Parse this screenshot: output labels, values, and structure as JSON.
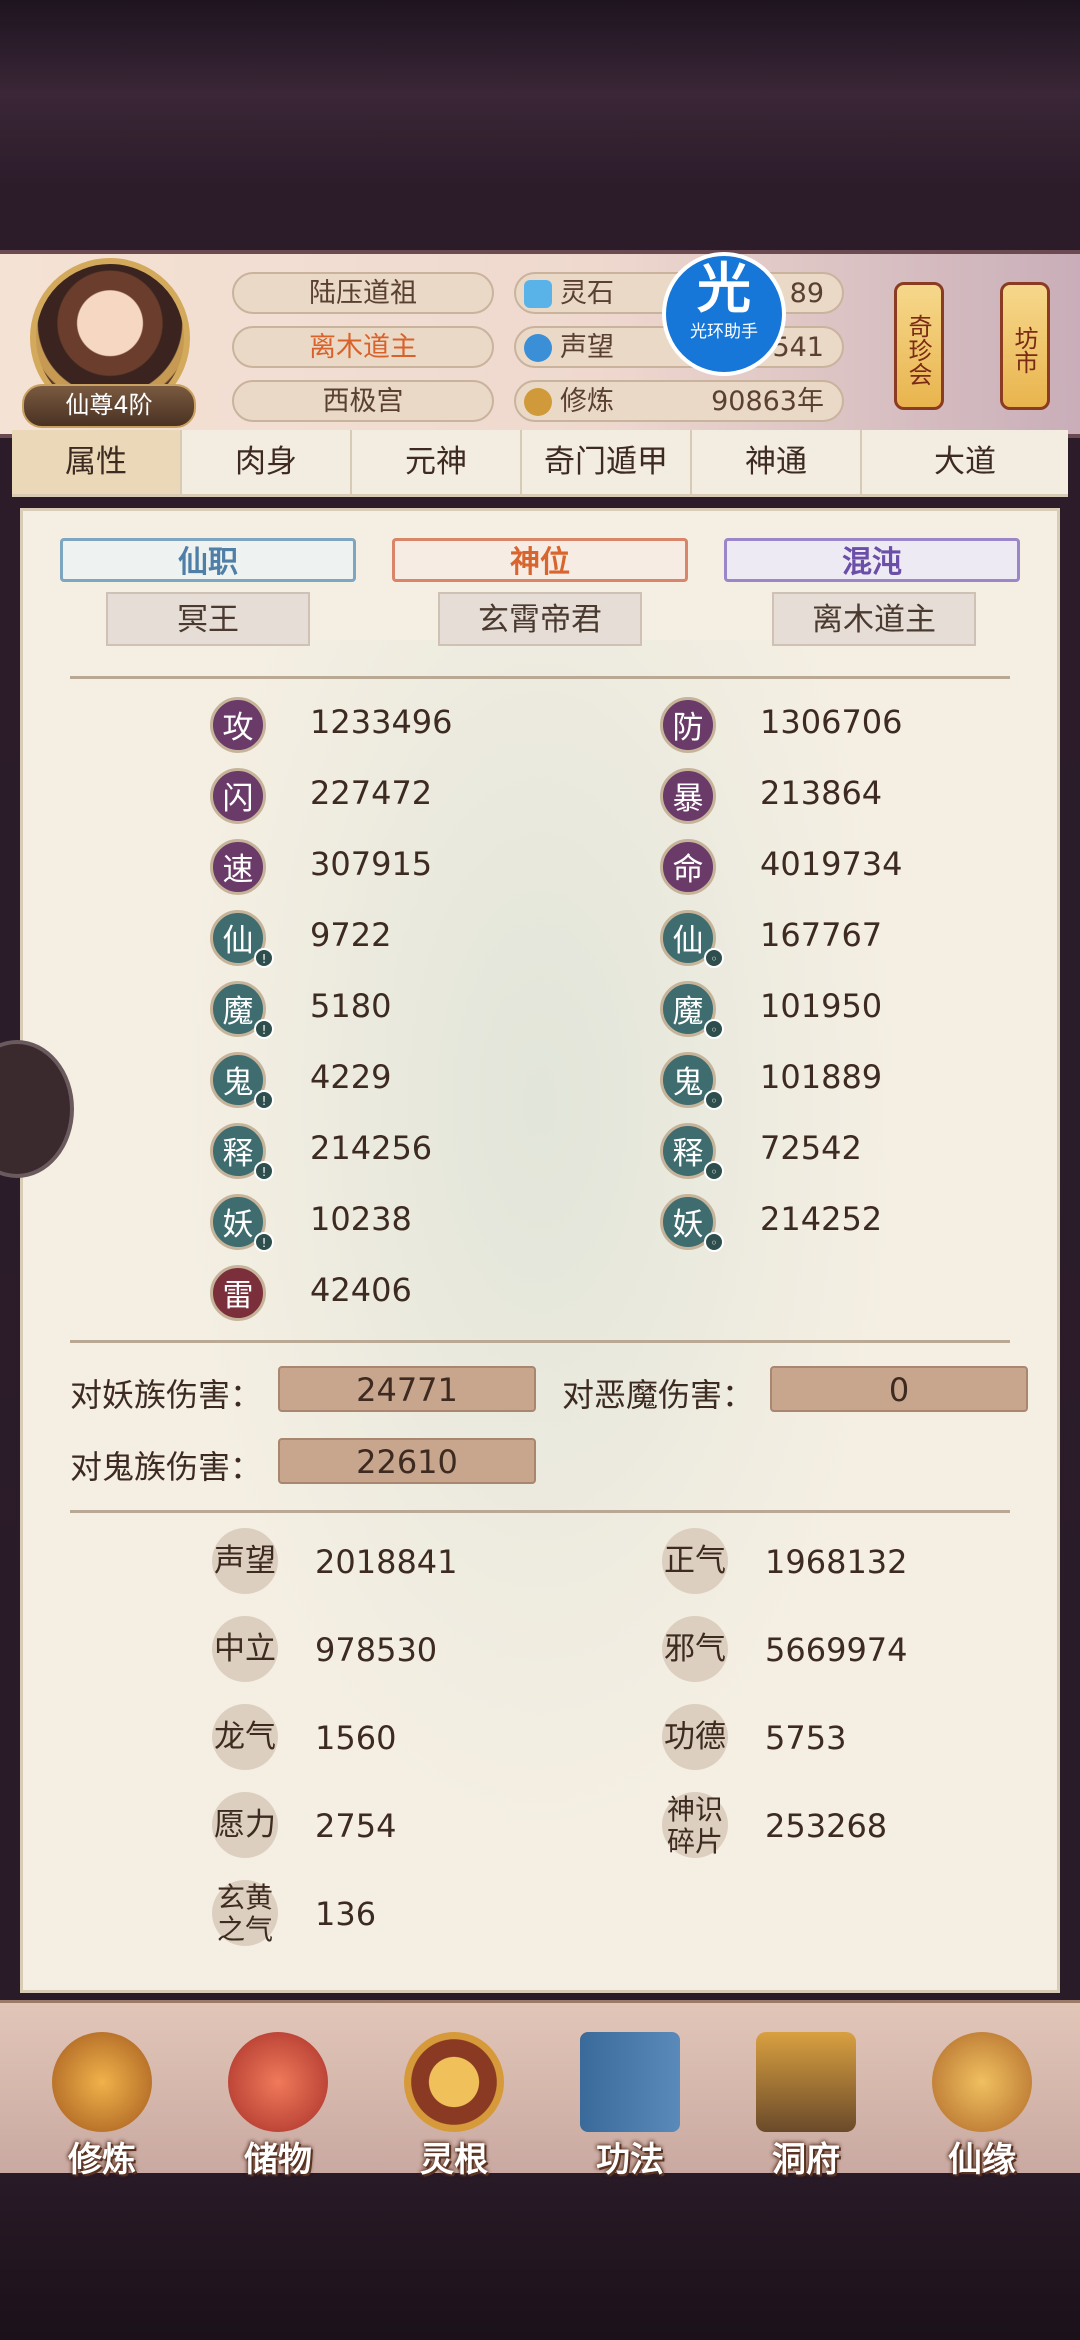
{
  "player": {
    "rank": "仙尊4阶"
  },
  "titles": [
    "陆压道祖",
    "离木道主",
    "西极宫"
  ],
  "resources": [
    {
      "label": "灵石",
      "value": "89",
      "icon": "spirit-stone-icon"
    },
    {
      "label": "声望",
      "value": "541",
      "icon": "reputation-icon"
    },
    {
      "label": "修炼",
      "value": "90863年",
      "icon": "cultivation-icon"
    }
  ],
  "lanterns": {
    "shop": "奇珍会",
    "market": "坊市"
  },
  "helper": {
    "glyph": "光",
    "label": "光环助手"
  },
  "tabs": [
    "属性",
    "肉身",
    "元神",
    "奇门遁甲",
    "神通",
    "大道"
  ],
  "positions": [
    {
      "ribbon": "仙职",
      "value": "冥王",
      "color": "#4f7fa6"
    },
    {
      "ribbon": "神位",
      "value": "玄霄帝君",
      "color": "#d8652e"
    },
    {
      "ribbon": "混沌",
      "value": "离木道主",
      "color": "#6b4ea8"
    }
  ],
  "stats_left": [
    {
      "badge": "攻",
      "value": "1233496"
    },
    {
      "badge": "闪",
      "value": "227472"
    },
    {
      "badge": "速",
      "value": "307915"
    },
    {
      "badge": "仙",
      "value": "9722"
    },
    {
      "badge": "魔",
      "value": "5180"
    },
    {
      "badge": "鬼",
      "value": "4229"
    },
    {
      "badge": "释",
      "value": "214256"
    },
    {
      "badge": "妖",
      "value": "10238"
    },
    {
      "badge": "雷",
      "value": "42406"
    }
  ],
  "stats_right": [
    {
      "badge": "防",
      "value": "1306706"
    },
    {
      "badge": "暴",
      "value": "213864"
    },
    {
      "badge": "命",
      "value": "4019734"
    },
    {
      "badge": "仙",
      "value": "167767"
    },
    {
      "badge": "魔",
      "value": "101950"
    },
    {
      "badge": "鬼",
      "value": "101889"
    },
    {
      "badge": "释",
      "value": "72542"
    },
    {
      "badge": "妖",
      "value": "214252"
    }
  ],
  "damage": [
    {
      "label": "对妖族伤害：",
      "value": "24771"
    },
    {
      "label": "对恶魔伤害：",
      "value": "0"
    },
    {
      "label": "对鬼族伤害：",
      "value": "22610"
    }
  ],
  "misc_left": [
    {
      "badge": "声望",
      "value": "2018841"
    },
    {
      "badge": "中立",
      "value": "978530"
    },
    {
      "badge": "龙气",
      "value": "1560"
    },
    {
      "badge": "愿力",
      "value": "2754"
    },
    {
      "badge": "玄黄之气",
      "value": "136"
    }
  ],
  "misc_right": [
    {
      "badge": "正气",
      "value": "1968132"
    },
    {
      "badge": "邪气",
      "value": "5669974"
    },
    {
      "badge": "功德",
      "value": "5753"
    },
    {
      "badge": "神识碎片",
      "value": "253268"
    }
  ],
  "nav": [
    "修炼",
    "储物",
    "灵根",
    "功法",
    "洞府",
    "仙缘"
  ],
  "colors": {
    "accent_orange": "#d9622a",
    "panel_bg": "#f5efe3",
    "badge_purple": "#6a3a68",
    "badge_teal": "#3f6c6e",
    "badge_red": "#7a2f3a"
  }
}
